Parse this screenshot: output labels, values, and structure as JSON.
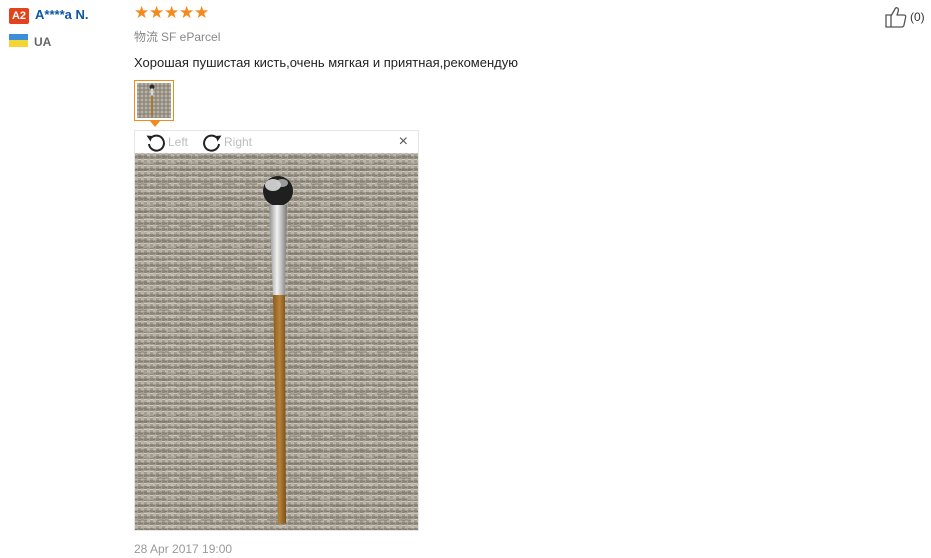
{
  "user": {
    "level_badge": "A2",
    "name": "A****a N.",
    "country": "UA"
  },
  "review": {
    "stars": 5,
    "shipping_label": "物流",
    "shipping_method": "SF eParcel",
    "text": "Хорошая пушистая кисть,очень мягкая и приятная,рекомендую",
    "helpful_count": "(0)",
    "date": "28 Apr 2017 19:00"
  },
  "viewer": {
    "rotate_left_label": "Left",
    "rotate_right_label": "Right",
    "close_symbol": "×"
  },
  "colors": {
    "star": "#f38a1c",
    "username": "#0b57a4",
    "badge": "#e2431c",
    "thumb_border": "#f38a1c"
  },
  "icons": {
    "helpful": "thumbs-up-icon",
    "rotate_left": "rotate-left-icon",
    "rotate_right": "rotate-right-icon",
    "close": "close-icon",
    "flag": "ukraine-flag-icon",
    "star": "star-icon"
  }
}
